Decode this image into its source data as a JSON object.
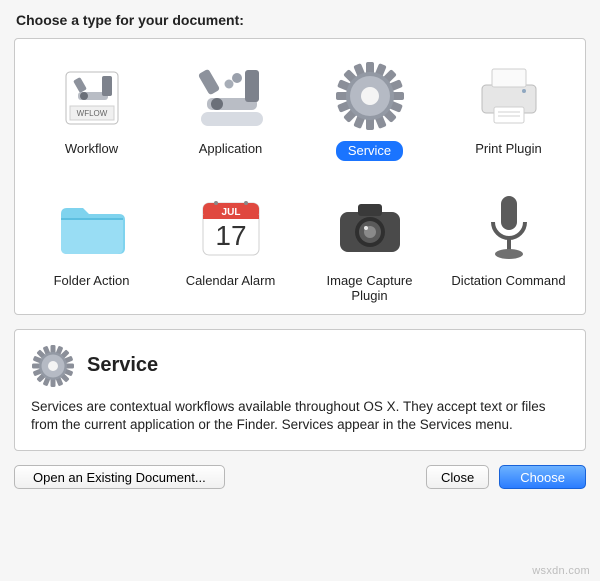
{
  "heading": "Choose a type for your document:",
  "items": [
    {
      "label": "Workflow"
    },
    {
      "label": "Application"
    },
    {
      "label": "Service"
    },
    {
      "label": "Print Plugin"
    },
    {
      "label": "Folder Action"
    },
    {
      "label": "Calendar Alarm"
    },
    {
      "label": "Image Capture Plugin"
    },
    {
      "label": "Dictation Command"
    }
  ],
  "selected_index": 2,
  "description": {
    "title": "Service",
    "body": "Services are contextual workflows available throughout OS X. They accept text or files from the current application or the Finder. Services appear in the Services menu."
  },
  "buttons": {
    "open": "Open an Existing Document...",
    "close": "Close",
    "choose": "Choose"
  },
  "watermark": "wsxdn.com",
  "calendar": {
    "month": "JUL",
    "day": "17"
  },
  "wflow_label": "WFLOW"
}
